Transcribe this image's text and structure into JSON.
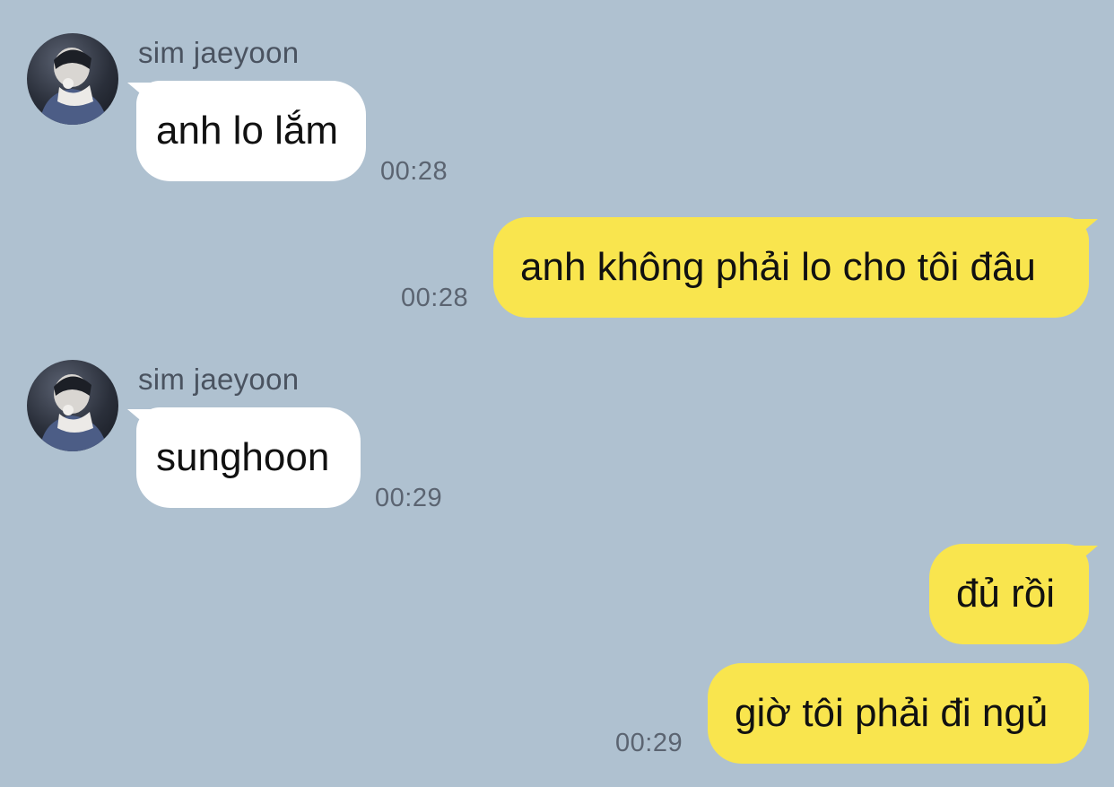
{
  "contact": {
    "name": "sim jaeyoon",
    "avatar_icon": "profile-photo"
  },
  "colors": {
    "background": "#afc1d0",
    "incoming_bubble": "#ffffff",
    "outgoing_bubble": "#f9e54e",
    "timestamp": "#5b6471"
  },
  "messages": [
    {
      "direction": "in",
      "sender": "sim jaeyoon",
      "text": "anh lo lắm",
      "time": "00:28"
    },
    {
      "direction": "out",
      "text": "anh không phải lo cho tôi đâu",
      "time": "00:28"
    },
    {
      "direction": "in",
      "sender": "sim jaeyoon",
      "text": "sunghoon",
      "time": "00:29"
    },
    {
      "direction": "out",
      "text": "đủ rồi",
      "time": ""
    },
    {
      "direction": "out",
      "text": "giờ tôi phải đi ngủ",
      "time": "00:29"
    }
  ]
}
